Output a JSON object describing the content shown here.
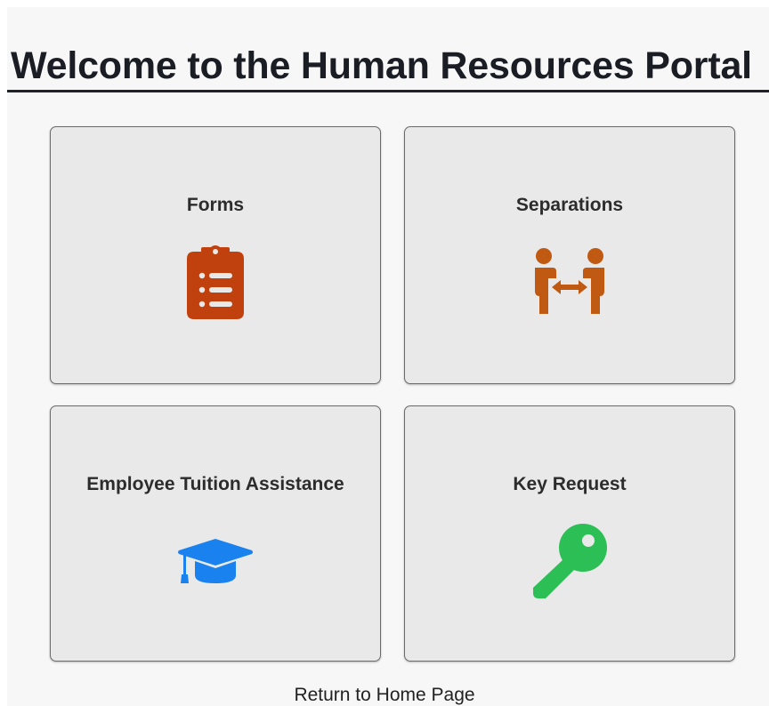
{
  "page": {
    "title": "Welcome to the Human Resources Portal"
  },
  "tiles": [
    {
      "label": "Forms",
      "icon": "clipboard-list-icon",
      "icon_color": "#c0400e"
    },
    {
      "label": "Separations",
      "icon": "people-arrows-icon",
      "icon_color": "#c05a12"
    },
    {
      "label": "Employee Tuition Assistance",
      "icon": "graduation-cap-icon",
      "icon_color": "#1a82ee"
    },
    {
      "label": "Key Request",
      "icon": "key-icon",
      "icon_color": "#2cbf55"
    }
  ],
  "footer": {
    "return_link": "Return to Home Page"
  },
  "colors": {
    "page_background": "#f7f7f7",
    "tile_background": "#e9e9e9",
    "tile_border": "#6a6a6a",
    "title_text": "#1a1d24"
  }
}
